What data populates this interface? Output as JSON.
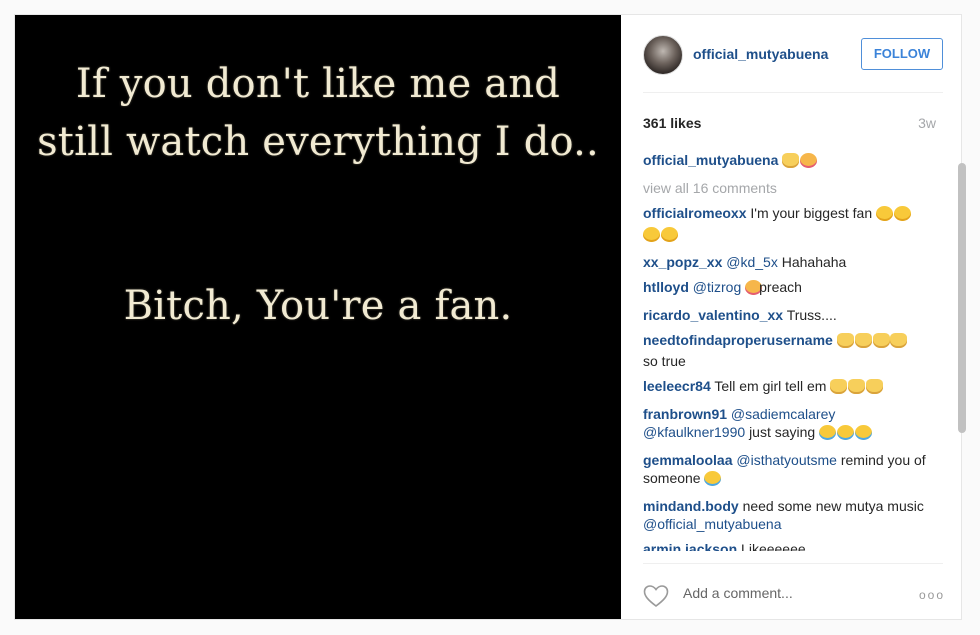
{
  "post": {
    "image_text": {
      "line1": "If you don't like me and",
      "line2": "still watch everything I do..",
      "line3": "Bitch, You're a fan."
    }
  },
  "header": {
    "username": "official_mutyabuena",
    "follow_label": "FOLLOW",
    "follow_color": "#3b83d9"
  },
  "stats": {
    "likes": "361 likes",
    "time": "3w"
  },
  "caption": {
    "user": "official_mutyabuena",
    "emoji_icons": [
      "clapping-hands-icon",
      "kissing-face-icon"
    ]
  },
  "view_all": "view all 16 comments",
  "comments": [
    {
      "user": "officialromeoxx",
      "text": "I'm your biggest fan"
    },
    {
      "user": "xx_popz_xx",
      "mention": "@kd_5x",
      "text": "Hahahaha"
    },
    {
      "user": "htlloyd",
      "mention": "@tizrog",
      "text": "preach"
    },
    {
      "user": "ricardo_valentino_xx",
      "text": "Truss...."
    },
    {
      "user": "needtofindaproperusername",
      "text": "so true"
    },
    {
      "user": "leeleecr84",
      "text": "Tell em girl tell em"
    },
    {
      "user": "franbrown91",
      "mention": "@sadiemcalarey",
      "mention2": "@kfaulkner1990",
      "text": "just saying"
    },
    {
      "user": "gemmaloolaa",
      "mention": "@isthatyoutsme",
      "text": "remind you of someone"
    },
    {
      "user": "mindand.body",
      "text": "need some new mutya music",
      "mention": "@official_mutyabuena"
    },
    {
      "user": "armin.jackson",
      "text": "Likeeeeee"
    }
  ],
  "add_comment": {
    "placeholder": "Add a comment...",
    "more_label": "ooo"
  },
  "colors": {
    "username_blue": "#1e4f8a",
    "muted_gray": "#a5a7aa",
    "image_bg": "#000000",
    "quote_text": "#f1ead2"
  }
}
